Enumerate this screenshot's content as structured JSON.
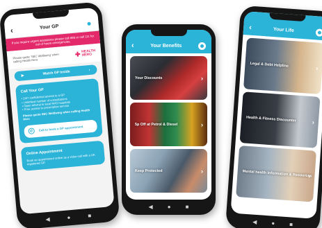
{
  "phones": {
    "gp": {
      "title": "Your GP",
      "alert": "If you require urgent assistance please call 999 or call 111 for out of hours emergencies.",
      "hh_text": "Please quote 'SEC Wellbeing' when calling Health Hero",
      "hh_logo_line1": "HEALTH",
      "hh_logo_line2": "HERO",
      "watch_btn": "Watch GP Inside",
      "call_card": {
        "heading": "Call Your GP",
        "lines": [
          "• 24/7 confidential access to a GP",
          "• Unlimited number of consultations",
          "• Open referral to local NHS hospitals",
          "• Free access to prescription service"
        ],
        "sub": "Please quote SEC Wellbeing when calling Health Hero",
        "btn": "Call to book a GP appointment"
      },
      "online_card": {
        "heading": "Online Appointment",
        "text": "Book an appointment online as a video call with a UK registered GP."
      }
    },
    "benefits": {
      "title": "Your Benefits",
      "tiles": [
        {
          "label": "Your Discounts"
        },
        {
          "label": "5p Off at Petrol & Diesel"
        },
        {
          "label": "Keep Protected"
        }
      ]
    },
    "life": {
      "title": "Your Life",
      "tiles": [
        {
          "label": "Legal & Debt Helpline"
        },
        {
          "label": "Health & Fitness Discounter"
        },
        {
          "label": "Mental health Information & Resources"
        }
      ]
    }
  },
  "nav": {
    "back": "◀",
    "home": "●",
    "recent": "■"
  },
  "colors": {
    "accent": "#2bb3d8",
    "alert": "#e4296a"
  }
}
